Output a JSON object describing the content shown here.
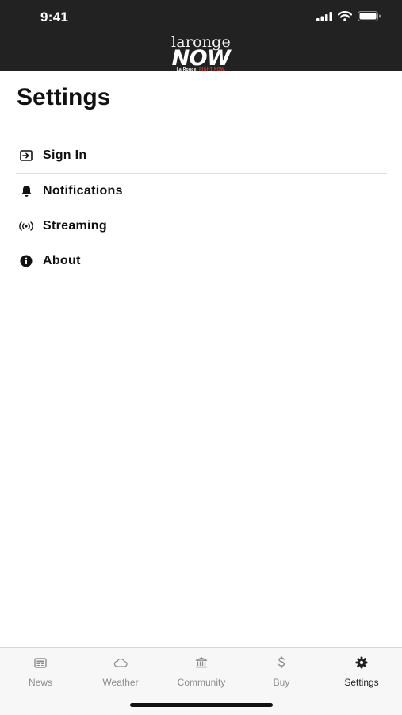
{
  "status_bar": {
    "time": "9:41"
  },
  "logo": {
    "top": "laronge",
    "main": "NOW",
    "tagline_white": "La Ronge.",
    "tagline_red": "RIGHT NOW."
  },
  "page": {
    "title": "Settings"
  },
  "menu": [
    {
      "label": "Sign In",
      "icon": "sign-in-icon"
    },
    {
      "label": "Notifications",
      "icon": "bell-icon"
    },
    {
      "label": "Streaming",
      "icon": "broadcast-icon"
    },
    {
      "label": "About",
      "icon": "info-icon"
    }
  ],
  "tabs": [
    {
      "label": "News",
      "icon": "newspaper-icon",
      "active": false
    },
    {
      "label": "Weather",
      "icon": "cloud-icon",
      "active": false
    },
    {
      "label": "Community",
      "icon": "building-icon",
      "active": false
    },
    {
      "label": "Buy",
      "icon": "dollar-icon",
      "active": false
    },
    {
      "label": "Settings",
      "icon": "gear-icon",
      "active": true
    }
  ],
  "colors": {
    "header_bg": "#222222",
    "accent_red": "#e0342c",
    "tab_inactive": "#8e8e8e",
    "tab_active": "#222222"
  }
}
